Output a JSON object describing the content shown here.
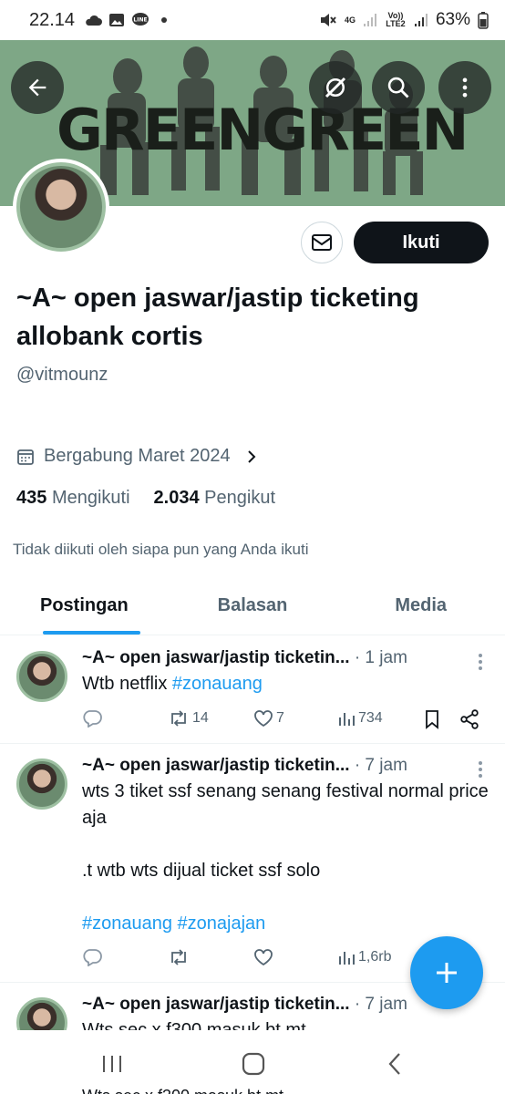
{
  "status_bar": {
    "time": "22.14",
    "battery": "63%",
    "net_top": "4G",
    "net_bottom": "Vo)) LTE2"
  },
  "banner": {
    "text": "GREENGREEN"
  },
  "actions": {
    "follow_label": "Ikuti"
  },
  "profile": {
    "name": "~A~ open jaswar/jastip ticketing allobank cortis",
    "handle": "@vitmounz",
    "joined": "Bergabung Maret 2024",
    "following_count": "435",
    "following_label": "Mengikuti",
    "followers_count": "2.034",
    "followers_label": "Pengikut",
    "not_followed_note": "Tidak diikuti oleh siapa pun yang Anda ikuti"
  },
  "tabs": [
    {
      "label": "Postingan",
      "active": true
    },
    {
      "label": "Balasan",
      "active": false
    },
    {
      "label": "Media",
      "active": false
    }
  ],
  "posts": [
    {
      "name": "~A~ open jaswar/jastip ticketin...",
      "time": "· 1 jam",
      "text": "Wtb netflix ",
      "tag": "#zonauang",
      "retweets": "14",
      "likes": "7",
      "views": "734"
    },
    {
      "name": "~A~ open jaswar/jastip ticketin...",
      "time": "· 7 jam",
      "line1": "wts 3 tiket ssf senang senang festival normal price aja",
      "line2": ".t wtb wts dijual ticket ssf solo",
      "tags": "#zonauang #zonajajan",
      "retweets": "",
      "likes": "",
      "views": "1,6rb"
    },
    {
      "name": "~A~ open jaswar/jastip ticketin...",
      "time": "· 7 jam",
      "text": "Wts sec x f300 masuk bt mt"
    }
  ],
  "peek_text": "Wts sec x f300 masuk bt mt",
  "colors": {
    "accent": "#1d9bf0",
    "banner": "#7ea786",
    "text": "#0f1419",
    "muted": "#536471"
  }
}
